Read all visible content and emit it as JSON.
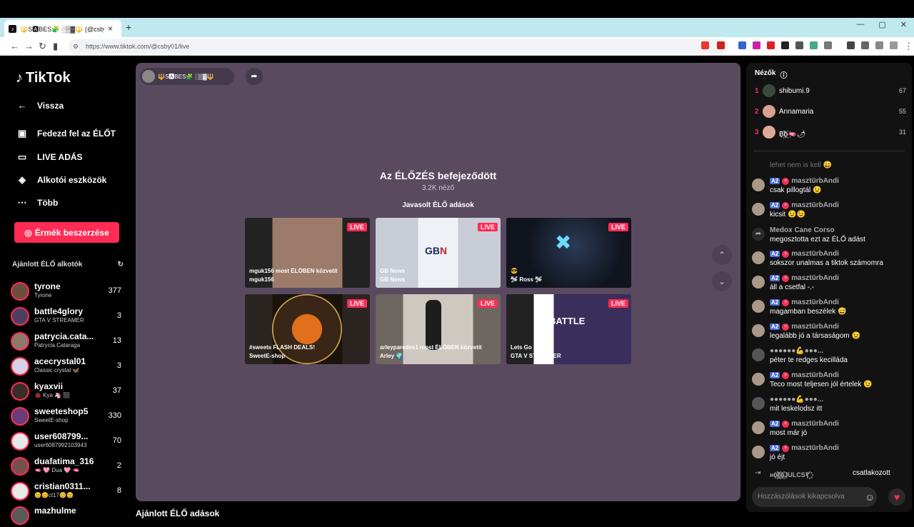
{
  "browser": {
    "tab_title": "🔱S🅰BES🧩 ░▒▓🔱 (@csby01)",
    "tab_close": "×",
    "new_tab": "+",
    "url": "https://www.tiktok.com/@csby01/live",
    "window_buttons": [
      "—",
      "▢",
      "✕"
    ]
  },
  "sidebar": {
    "logo": "TikTok",
    "nav": [
      {
        "label": "Vissza",
        "icon": "arrow-left-icon"
      },
      {
        "label": "Fedezd fel az ÉLŐT",
        "icon": "explore-icon"
      },
      {
        "label": "LIVE ADÁS",
        "icon": "camera-icon"
      },
      {
        "label": "Alkotói eszközök",
        "icon": "creator-tools-icon"
      },
      {
        "label": "Több",
        "icon": "more-icon"
      }
    ],
    "coins_button": "Érmék beszerzése",
    "recommended_heading": "Ajánlott ÉLŐ alkotók",
    "creators": [
      {
        "name": "tyrone",
        "sub": "Tyrone",
        "count": "377"
      },
      {
        "name": "battle4glory",
        "sub": "GTA V STREAMER",
        "count": "3"
      },
      {
        "name": "patrycia.cata...",
        "sub": "Patrycia.Cataraga",
        "count": "13"
      },
      {
        "name": "acecrystal01",
        "sub": "Classic crystal 🦋",
        "count": "3"
      },
      {
        "name": "kyaxvii",
        "sub": "🐞 Kya 🦄 ⬛",
        "count": "37"
      },
      {
        "name": "sweeteshop5",
        "sub": "SweetE-shop",
        "count": "330"
      },
      {
        "name": "user608799...",
        "sub": "user6087992103943",
        "count": "70"
      },
      {
        "name": "duafatima_316",
        "sub": "🫦 🩷 Dua 🩷 🫦",
        "count": "2"
      },
      {
        "name": "cristian0311...",
        "sub": "😊😊ct17😊😊",
        "count": "8"
      },
      {
        "name": "mazhulme",
        "sub": "",
        "count": ""
      }
    ],
    "bottom_heading": "Ajánlott ÉLŐ adások"
  },
  "player": {
    "host_name": "🔱S🅰BES🧩 ░▒▓🔱",
    "ended_text": "Az ÉLŐZÉS befejeződött",
    "viewers_text": "3.2K néző",
    "recommended_label": "Javasolt ÉLŐ adások",
    "live_badge": "LIVE",
    "cards": [
      {
        "title": "mguk156 most ÉLŐBEN közvetít",
        "sub": "mguk156",
        "color": "#8a6a5c"
      },
      {
        "title": "GB News",
        "sub": "GB News",
        "color": "#dfe5ee"
      },
      {
        "title": "😎",
        "sub": "🛩 Ross 🛩",
        "color": "#1a2030"
      },
      {
        "title": "#sweets FLASH DEALS!",
        "sub": "SweetE-shop",
        "color": "#3a2a1a"
      },
      {
        "title": "arleyparedes1 most ÉLŐBEN közvetít",
        "sub": "Arley 🌍",
        "color": "#8a8078"
      },
      {
        "title": "Lets Go",
        "sub": "GTA V STREAMER",
        "color": "#4a3a6a"
      }
    ]
  },
  "chat": {
    "viewers_heading": "Nézők",
    "top_viewers": [
      {
        "rank": "1",
        "name": "shibumi.9",
        "score": "67"
      },
      {
        "rank": "2",
        "name": "Annamaria",
        "score": "55"
      },
      {
        "rank": "3",
        "name": "B꙰b꙰🫦🌶",
        "score": "31"
      }
    ],
    "partial_message": "lehet nem is kell 😄",
    "messages": [
      {
        "user": "masztürbAndi",
        "level": "A2",
        "text": "csak pillogtál 😉"
      },
      {
        "user": "masztürbAndi",
        "level": "A2",
        "text": "kicsit 😉😉"
      },
      {
        "user": "Medox Cane Corso",
        "level": "",
        "text": "megosztotta ezt az ÉLŐ adást"
      },
      {
        "user": "masztürbAndi",
        "level": "A2",
        "text": "sokszor unalmas a tiktok számomra"
      },
      {
        "user": "masztürbAndi",
        "level": "A2",
        "text": "áll a csetfal -.-"
      },
      {
        "user": "masztürbAndi",
        "level": "A2",
        "text": "magamban beszélek 😅"
      },
      {
        "user": "masztürbAndi",
        "level": "A2",
        "text": "legalább jó a társaságom 😉"
      },
      {
        "user": "●●●●●●💪●●●...",
        "level": "",
        "text": "péter te redges kecilláda"
      },
      {
        "user": "masztürbAndi",
        "level": "A2",
        "text": "Teco most teljesen jól értelek 😉"
      },
      {
        "user": "●●●●●●💪●●●...",
        "level": "",
        "text": "mit leskelodsz itt"
      },
      {
        "user": "masztürbAndi",
        "level": "A2",
        "text": "most már jó"
      },
      {
        "user": "masztürbAndi",
        "level": "A2",
        "text": "jó éjt"
      }
    ],
    "join_user": "ʜᴜ꙰ϵ꙰ɢ꙰JULCSY꙰",
    "join_text": "csatlakozott",
    "input_placeholder": "Hozzászólások kikapcsolva"
  }
}
